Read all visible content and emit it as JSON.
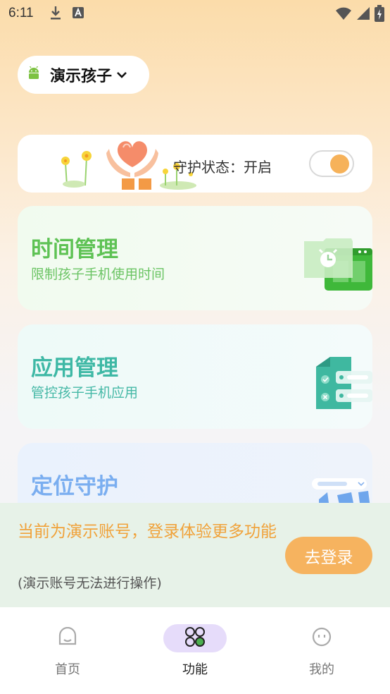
{
  "status_bar": {
    "time": "6:11",
    "left_icons": [
      "download-icon",
      "text-a-icon"
    ],
    "right_icons": [
      "wifi-icon",
      "signal-icon",
      "battery-charging-icon"
    ]
  },
  "child_selector": {
    "name": "演示孩子",
    "icon": "android-icon"
  },
  "protection": {
    "label": "守护状态：开启",
    "toggle_on": true
  },
  "features": [
    {
      "title": "时间管理",
      "subtitle": "限制孩子手机使用时间",
      "icon": "clock-calendar-icon"
    },
    {
      "title": "应用管理",
      "subtitle": "管控孩子手机应用",
      "icon": "app-list-icon"
    },
    {
      "title": "定位守护",
      "subtitle": "",
      "icon": "location-icon"
    }
  ],
  "login_banner": {
    "message": "当前为演示账号，登录体验更多功能",
    "note": "(演示账号无法进行操作)",
    "button": "去登录"
  },
  "bottom_nav": {
    "items": [
      {
        "label": "首页",
        "icon": "home-icon"
      },
      {
        "label": "功能",
        "icon": "apps-icon",
        "active": true
      },
      {
        "label": "我的",
        "icon": "profile-icon"
      }
    ]
  },
  "colors": {
    "accent_orange": "#f6b35f",
    "time_green": "#5ec254",
    "app_teal": "#3eb8a5",
    "location_blue": "#7aaef0"
  }
}
